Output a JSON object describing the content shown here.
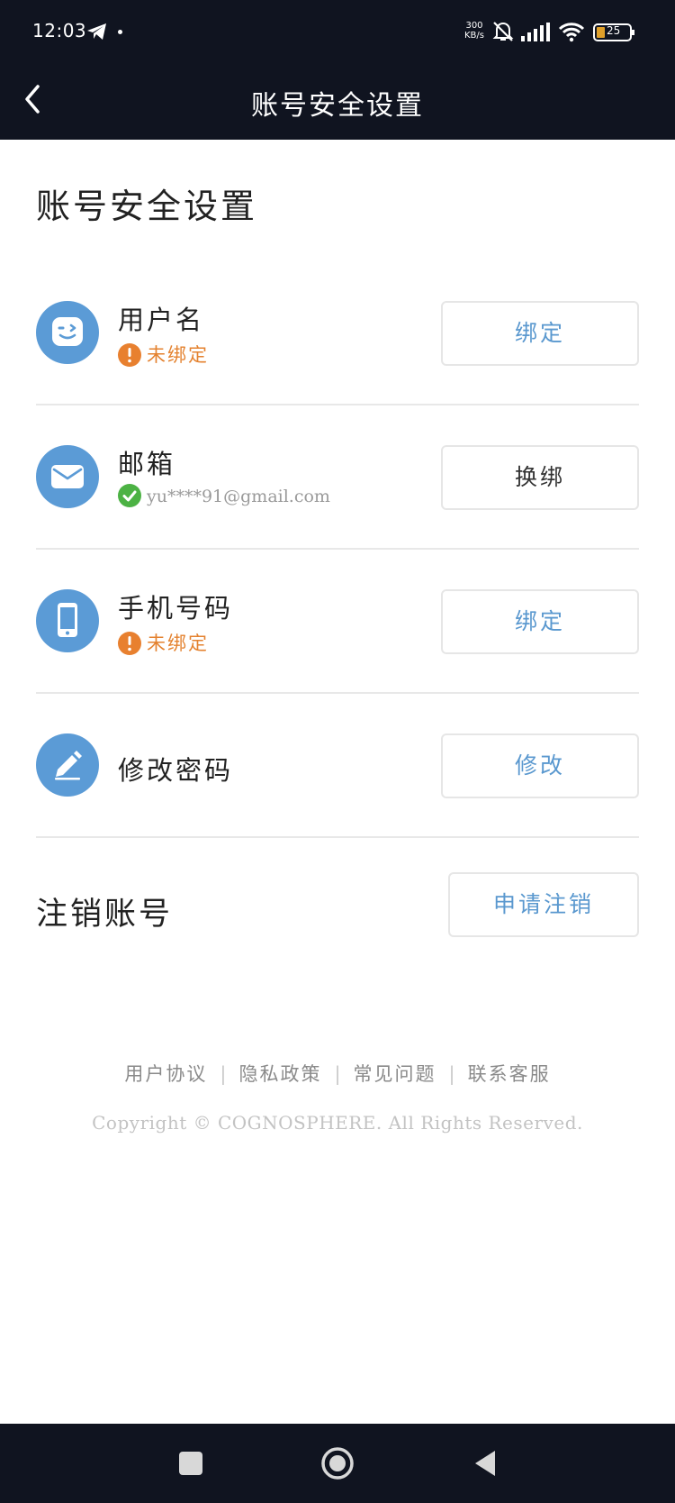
{
  "status_bar": {
    "time": "12:03",
    "speed_value": "300",
    "speed_unit": "KB/s",
    "battery": "25"
  },
  "header": {
    "title": "账号安全设置"
  },
  "page": {
    "title": "账号安全设置"
  },
  "rows": [
    {
      "label": "用户名",
      "status": "未绑定",
      "status_type": "warning",
      "button": "绑定",
      "icon": "face-icon"
    },
    {
      "label": "邮箱",
      "status": "yu****91@gmail.com",
      "status_type": "ok",
      "button": "换绑",
      "icon": "mail-icon"
    },
    {
      "label": "手机号码",
      "status": "未绑定",
      "status_type": "warning",
      "button": "绑定",
      "icon": "phone-icon"
    },
    {
      "label": "修改密码",
      "button": "修改",
      "icon": "pencil-icon"
    }
  ],
  "cancel_account": {
    "label": "注销账号",
    "button": "申请注销"
  },
  "footer": {
    "links": [
      "用户协议",
      "隐私政策",
      "常见问题",
      "联系客服"
    ],
    "separator": "|",
    "copyright": "Copyright © COGNOSPHERE. All Rights Reserved."
  },
  "colors": {
    "topbar": "#101420",
    "icon_circle": "#5b9bd6",
    "warning": "#e8802f",
    "ok": "#4cb244",
    "button_text": "#5a98cf"
  }
}
